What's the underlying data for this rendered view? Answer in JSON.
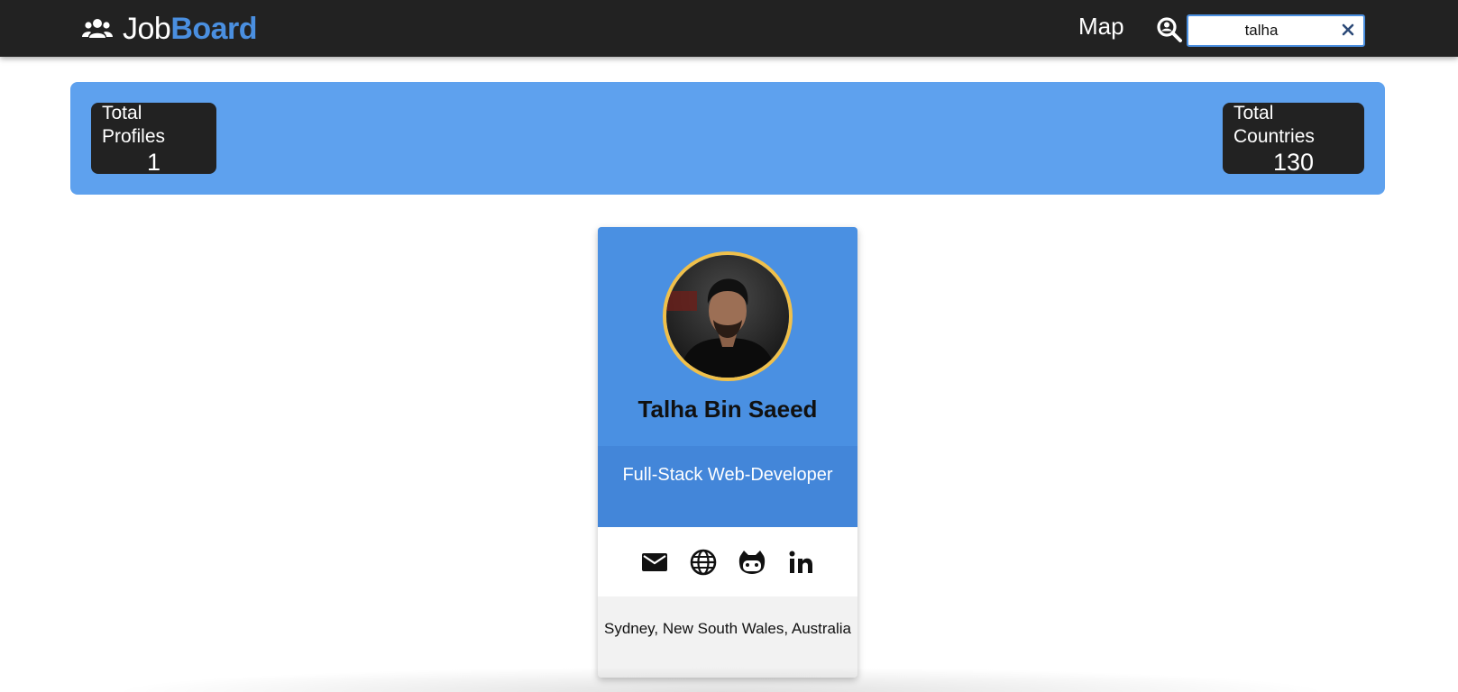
{
  "navbar": {
    "brand_light": "Job",
    "brand_bold": "Board",
    "brand_icon": "people-group-icon",
    "map_label": "Map",
    "search": {
      "icon": "search-user-icon",
      "value": "talha",
      "clear_icon": "close-icon"
    }
  },
  "stats": {
    "profiles_label": "Total Profiles",
    "profiles_value": "1",
    "countries_label": "Total Countries",
    "countries_value": "130"
  },
  "profile_card": {
    "name": "Talha Bin Saeed",
    "role": "Full-Stack Web-Developer",
    "location": "Sydney, New South Wales, Australia",
    "links": [
      "email-icon",
      "website-globe-icon",
      "github-icon",
      "linkedin-icon"
    ]
  },
  "colors": {
    "navbar_bg": "#222222",
    "accent_blue": "#4a8fe0",
    "stats_bar_bg": "#5ea1ee",
    "card_top_bg": "#4a90e2",
    "avatar_border": "#f0c04a"
  }
}
